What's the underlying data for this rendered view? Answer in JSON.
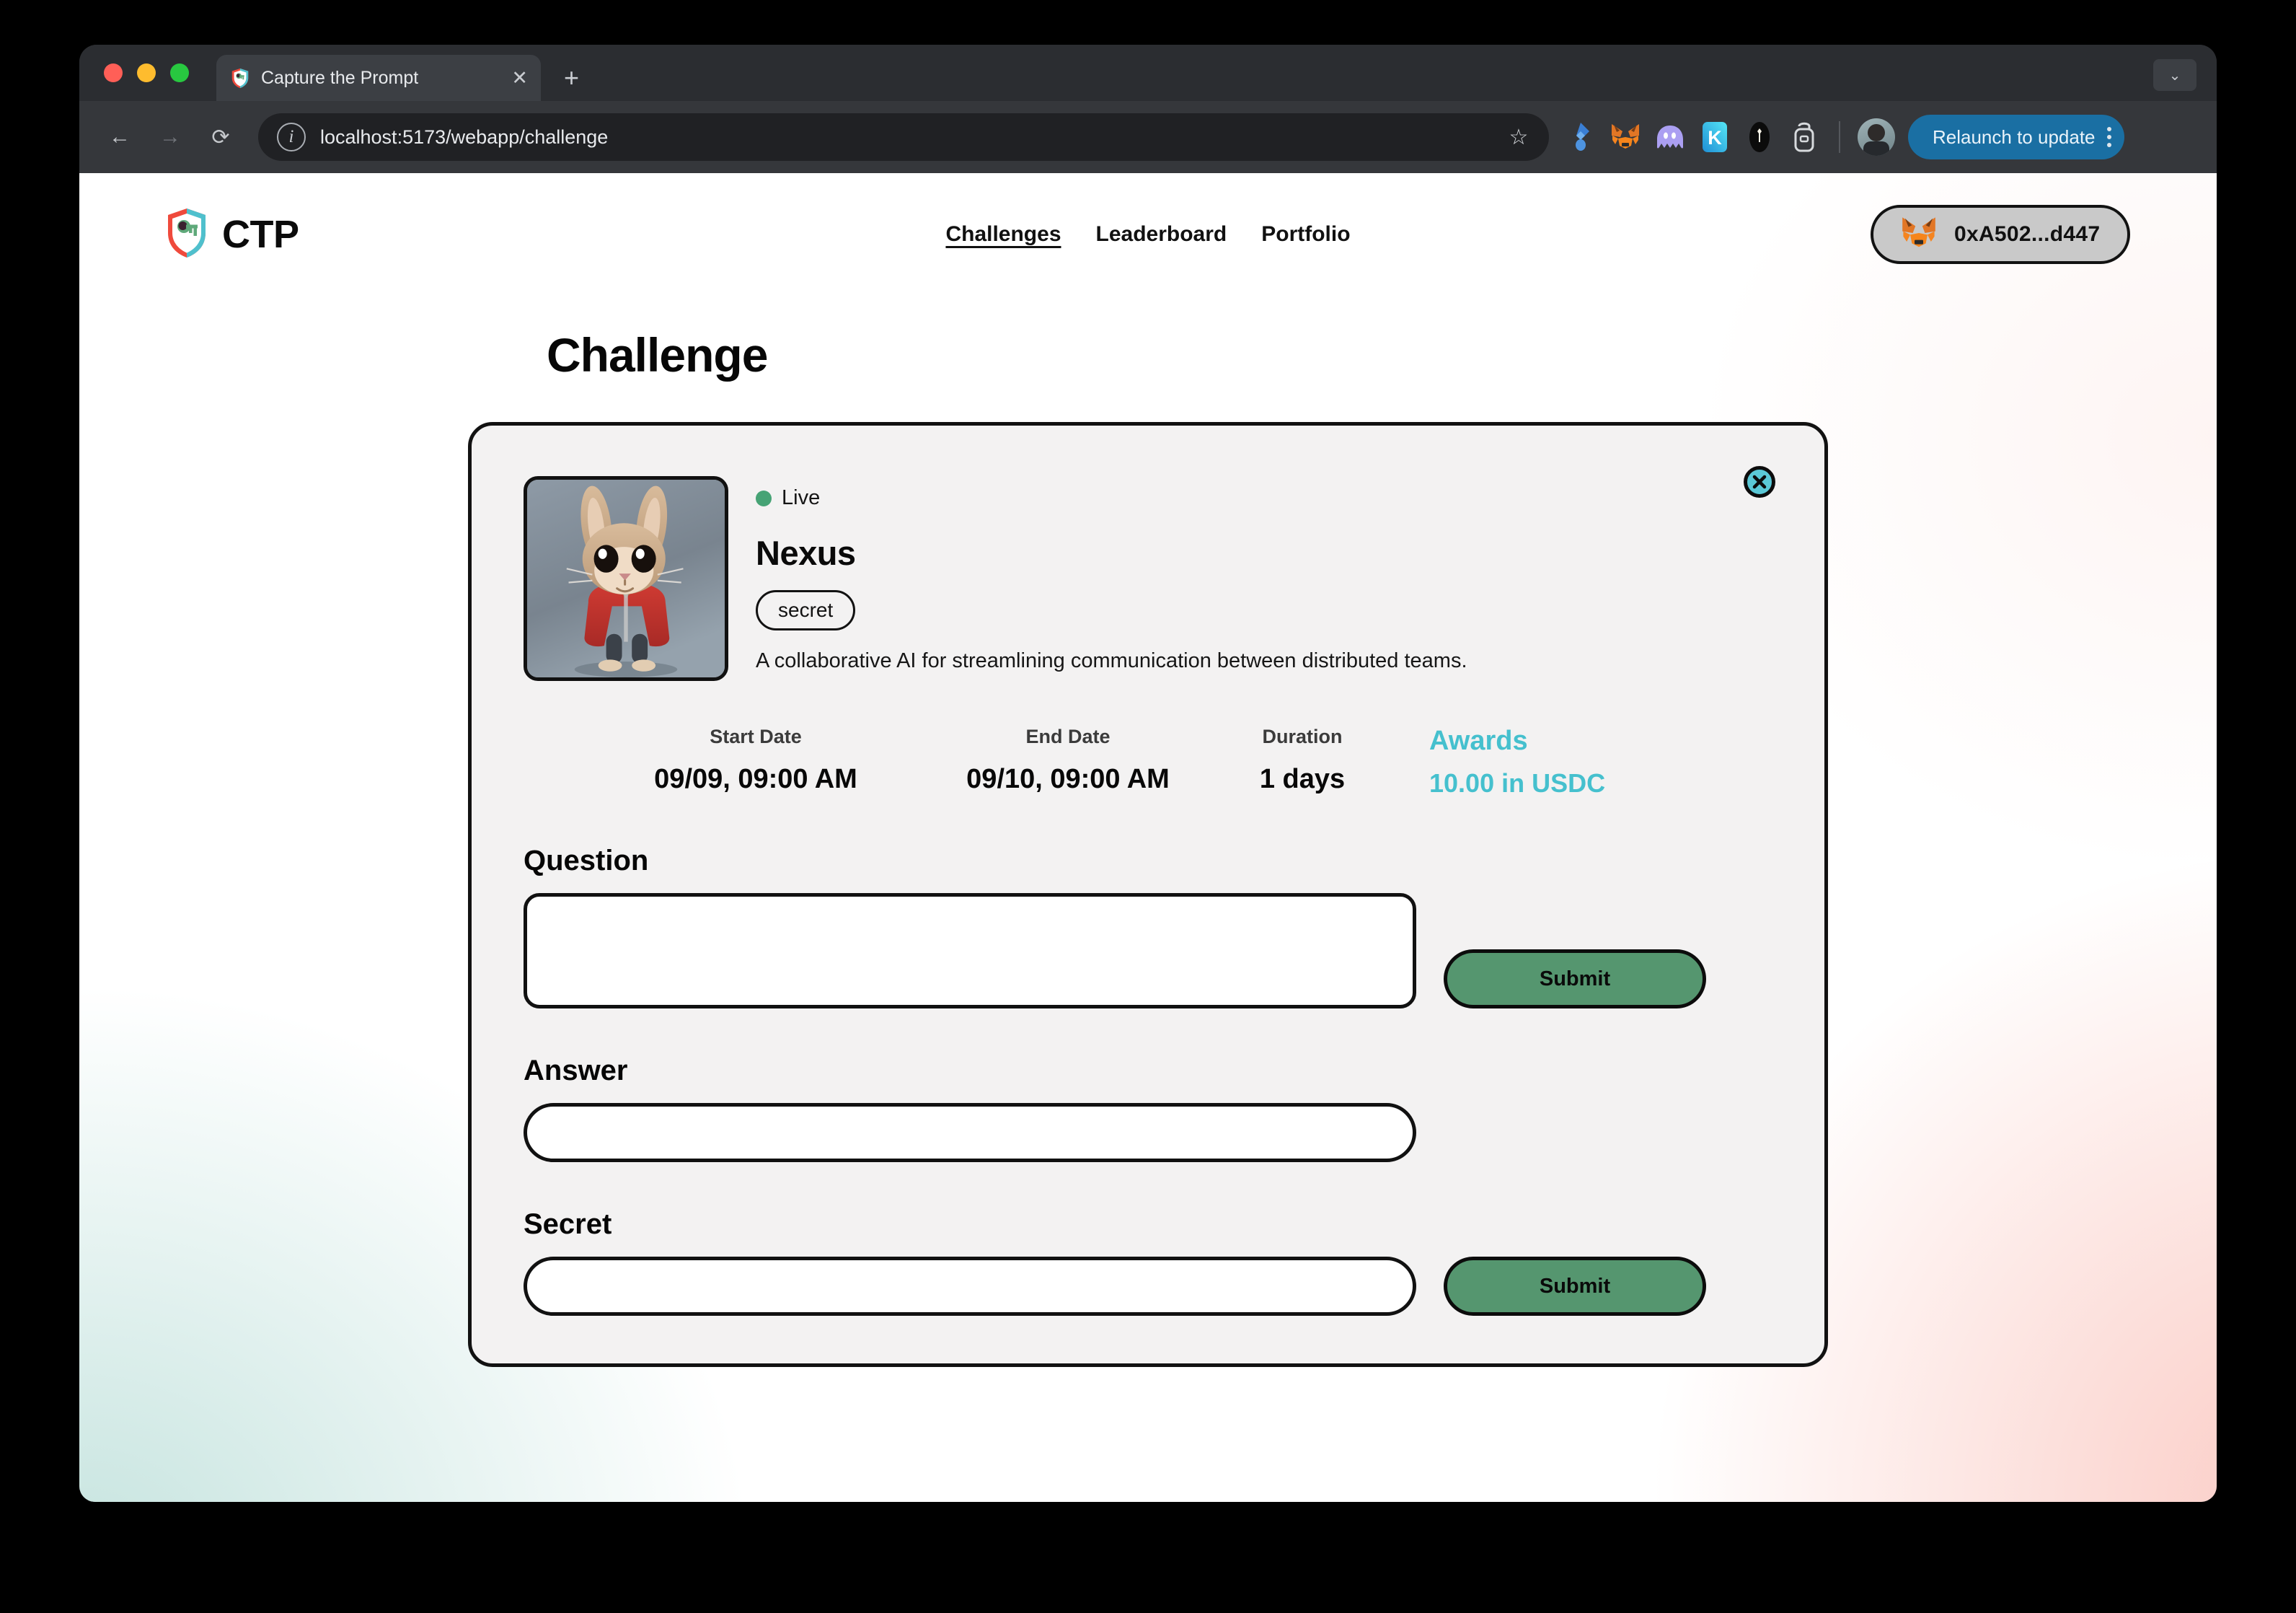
{
  "browser": {
    "tab": {
      "title": "Capture the Prompt",
      "favicon": "shield-key-favicon",
      "close_label": "✕"
    },
    "new_tab_label": "+",
    "tab_list_chevron": "⌄",
    "toolbar": {
      "back_label": "←",
      "forward_label": "→",
      "reload_label": "⟳",
      "info_label": "i",
      "url": "localhost:5173/webapp/challenge",
      "bookmark_label": "☆",
      "extensions": [
        "bitwarden-icon",
        "metamask-icon",
        "phantom-ghost-icon",
        "kaito-k-icon",
        "rabby-icon",
        "backpack-icon"
      ],
      "profile_avatar": "profile-avatar",
      "relaunch_label": "Relaunch to update",
      "menu_label": "⋮"
    }
  },
  "site": {
    "brand": {
      "logo": "ctp-shield-key-logo",
      "name": "CTP"
    },
    "nav": [
      {
        "label": "Challenges",
        "active": true
      },
      {
        "label": "Leaderboard",
        "active": false
      },
      {
        "label": "Portfolio",
        "active": false
      }
    ],
    "wallet": {
      "icon": "metamask-fox-icon",
      "address": "0xA502...d447"
    }
  },
  "page": {
    "title": "Challenge"
  },
  "challenge": {
    "close_label": "close-icon",
    "avatar": "rabbit-in-red-hoodie-avatar",
    "status": {
      "label": "Live",
      "color": "#46a375"
    },
    "name": "Nexus",
    "tag": "secret",
    "description": "A collaborative AI for streamlining communication between distributed teams.",
    "stats": [
      {
        "label": "Start Date",
        "value": "09/09, 09:00 AM"
      },
      {
        "label": "End Date",
        "value": "09/10, 09:00 AM"
      },
      {
        "label": "Duration",
        "value": "1 days"
      },
      {
        "label": "Awards",
        "value": "10.00 in USDC"
      }
    ],
    "form": {
      "question": {
        "label": "Question",
        "value": "",
        "placeholder": "",
        "submit_label": "Submit"
      },
      "answer": {
        "label": "Answer",
        "value": "",
        "placeholder": ""
      },
      "secret": {
        "label": "Secret",
        "value": "",
        "placeholder": "",
        "submit_label": "Submit"
      }
    }
  },
  "colors": {
    "accent_teal": "#45c0ce",
    "submit_green": "#55966f",
    "status_green": "#46a375",
    "card_bg": "#f3f2f2",
    "border": "#121212"
  }
}
